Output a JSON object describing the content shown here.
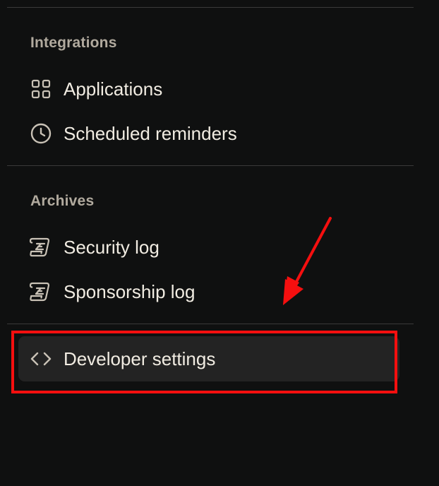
{
  "sections": [
    {
      "title": "Integrations",
      "items": [
        {
          "label": "Applications",
          "icon": "apps-grid-icon"
        },
        {
          "label": "Scheduled reminders",
          "icon": "clock-icon"
        }
      ]
    },
    {
      "title": "Archives",
      "items": [
        {
          "label": "Security log",
          "icon": "log-icon"
        },
        {
          "label": "Sponsorship log",
          "icon": "log-icon"
        }
      ]
    }
  ],
  "developer_settings": {
    "label": "Developer settings",
    "icon": "code-icon",
    "active": true
  },
  "colors": {
    "background": "#0f1010",
    "section_title": "#b1aa9e",
    "label": "#f1ece2",
    "icon": "#c9c2b6",
    "active_bg": "#232323",
    "annotation_red": "#f50f0f"
  }
}
